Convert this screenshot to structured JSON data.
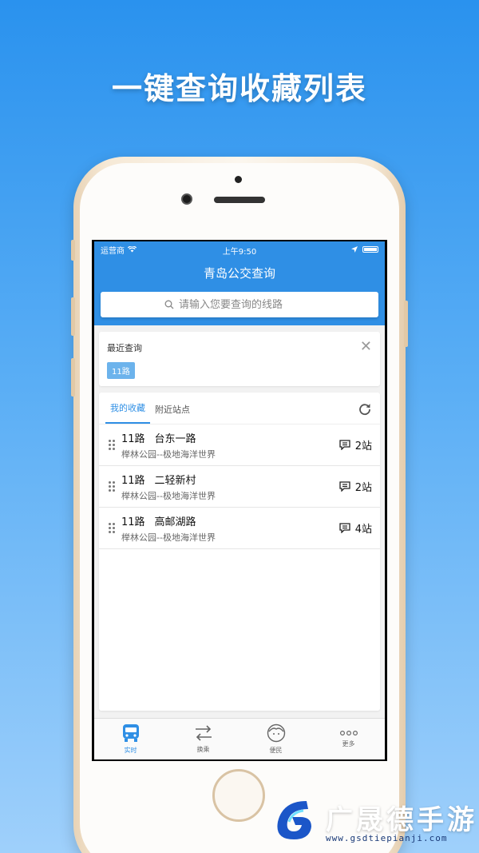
{
  "promo": {
    "headline": "一键查询收藏列表"
  },
  "status_bar": {
    "carrier": "运营商",
    "time": "上午9:50"
  },
  "app": {
    "title": "青岛公交查询"
  },
  "search": {
    "placeholder": "请输入您要查询的线路"
  },
  "recent": {
    "title": "最近查询",
    "tags": [
      "11路"
    ]
  },
  "tabs": [
    {
      "label": "我的收藏",
      "active": true
    },
    {
      "label": "附近站点",
      "active": false
    }
  ],
  "favorites": [
    {
      "route": "11路",
      "stop": "台东一路",
      "direction": "榉林公园--极地海洋世界",
      "stops_away": "2站"
    },
    {
      "route": "11路",
      "stop": "二轻新村",
      "direction": "榉林公园--极地海洋世界",
      "stops_away": "2站"
    },
    {
      "route": "11路",
      "stop": "高邮湖路",
      "direction": "榉林公园--极地海洋世界",
      "stops_away": "4站"
    }
  ],
  "tabbar": [
    {
      "label": "实时",
      "icon": "bus-icon",
      "active": true
    },
    {
      "label": "换乘",
      "icon": "transfer-icon",
      "active": false
    },
    {
      "label": "便民",
      "icon": "face-icon",
      "active": false
    },
    {
      "label": "更多",
      "icon": "more-icon",
      "active": false
    }
  ],
  "watermark": {
    "brand": "广晟德手游",
    "url": "www.gsdtiepianji.com"
  },
  "colors": {
    "primary": "#2f8fe5",
    "tag": "#6cb3ec",
    "background_top": "#2a92ee",
    "background_bottom": "#9fd0fb"
  }
}
